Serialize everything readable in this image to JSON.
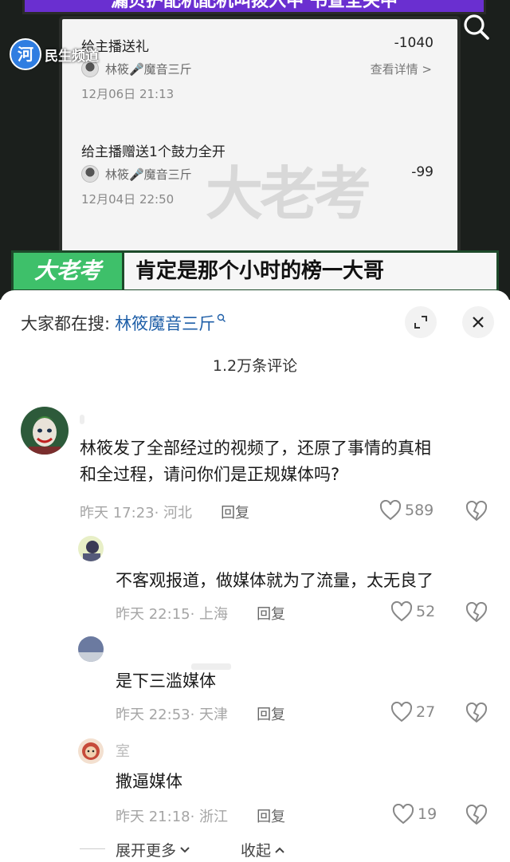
{
  "video": {
    "banner_text": "漏贝护配机配机叫拨入中 书查全关中",
    "channel_logo_text": "民生频道",
    "transactions": [
      {
        "title": "给主播送礼",
        "amount": "-1040",
        "user": "林筱🎤魔音三斤",
        "detail": "查看详情 >",
        "time": "12月06日 21:13"
      },
      {
        "title": "给主播赠送1个鼓力全开",
        "amount": "-99",
        "user": "林筱🎤魔音三斤",
        "detail": "",
        "time": "12月04日 22:50"
      }
    ],
    "watermark": "大老考",
    "subtitle_logo": "大老考",
    "subtitle": "肯定是那个小时的榜一大哥"
  },
  "sheet": {
    "search_prefix": "大家都在搜:",
    "search_keyword": "林筱魔音三斤",
    "comment_count": "1.2万条评论"
  },
  "comments": [
    {
      "text_line1": "林筱发了全部经过的视频了，还原了事情的真相",
      "text_line2": "和全过程，请问你们是正规媒体吗?",
      "time": "昨天 17:23",
      "location": "· 河北",
      "reply": "回复",
      "likes": "589"
    },
    {
      "text": "不客观报道，做媒体就为了流量，太无良了",
      "time": "昨天 22:15",
      "location": "· 上海",
      "reply": "回复",
      "likes": "52"
    },
    {
      "text": "是下三滥媒体",
      "time": "昨天 22:53",
      "location": "· 天津",
      "reply": "回复",
      "likes": "27"
    },
    {
      "name_partial": "室",
      "text": "撒逼媒体",
      "time": "昨天 21:18",
      "location": "· 浙江",
      "reply": "回复",
      "likes": "19"
    }
  ],
  "footer": {
    "expand": "展开更多",
    "collapse": "收起"
  },
  "colors": {
    "accent_link": "#1f5fa8",
    "subtitle_green": "#3ec06a",
    "banner_purple": "#6a2fd0"
  }
}
